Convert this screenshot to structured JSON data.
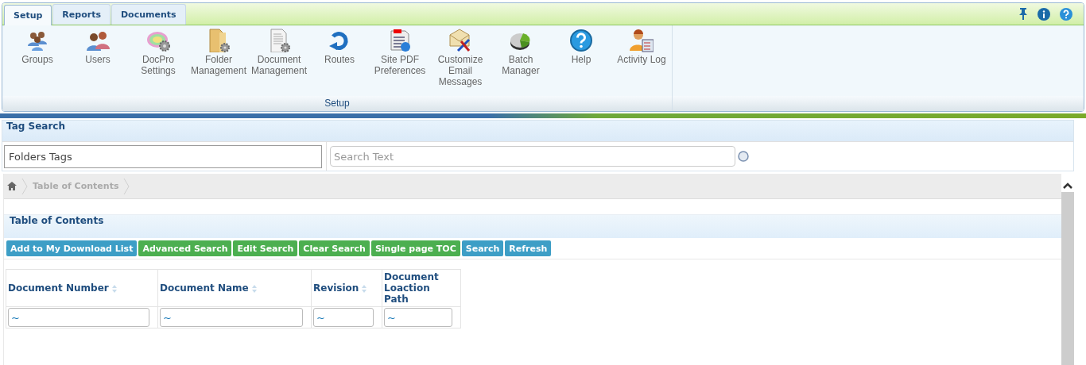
{
  "ribbon": {
    "tabs": [
      {
        "label": "Setup",
        "selected": true
      },
      {
        "label": "Reports",
        "selected": false
      },
      {
        "label": "Documents",
        "selected": false
      }
    ],
    "items": [
      {
        "label": "Groups"
      },
      {
        "label": "Users"
      },
      {
        "label": "DocPro Settings"
      },
      {
        "label": "Folder Management"
      },
      {
        "label": "Document Management"
      },
      {
        "label": "Routes"
      },
      {
        "label": "Site PDF Preferences"
      },
      {
        "label": "Customize Email Messages"
      },
      {
        "label": "Batch Manager"
      },
      {
        "label": "Help"
      },
      {
        "label": "Activity Log"
      }
    ],
    "group_label": "Setup"
  },
  "tag_search": {
    "title": "Tag Search",
    "folders_field": {
      "value": "Folders Tags"
    },
    "search_field": {
      "placeholder": "Search Text"
    }
  },
  "breadcrumb": {
    "items": [
      "Table of Contents"
    ]
  },
  "toc": {
    "title": "Table of Contents",
    "buttons": [
      {
        "label": "Add to My Download List",
        "kind": "primary"
      },
      {
        "label": "Advanced Search",
        "kind": "success"
      },
      {
        "label": "Edit Search",
        "kind": "success"
      },
      {
        "label": "Clear Search",
        "kind": "success"
      },
      {
        "label": "Single page TOC",
        "kind": "success"
      },
      {
        "label": "Search",
        "kind": "primary"
      },
      {
        "label": "Refresh",
        "kind": "primary"
      }
    ],
    "table": {
      "columns": [
        {
          "label": "Document Number",
          "sortable": true
        },
        {
          "label": "Document Name",
          "sortable": true
        },
        {
          "label": "Revision",
          "sortable": true
        },
        {
          "label": "Document Loaction Path",
          "sortable": false
        }
      ],
      "filters": [
        "~",
        "~",
        "~",
        "~"
      ]
    }
  }
}
